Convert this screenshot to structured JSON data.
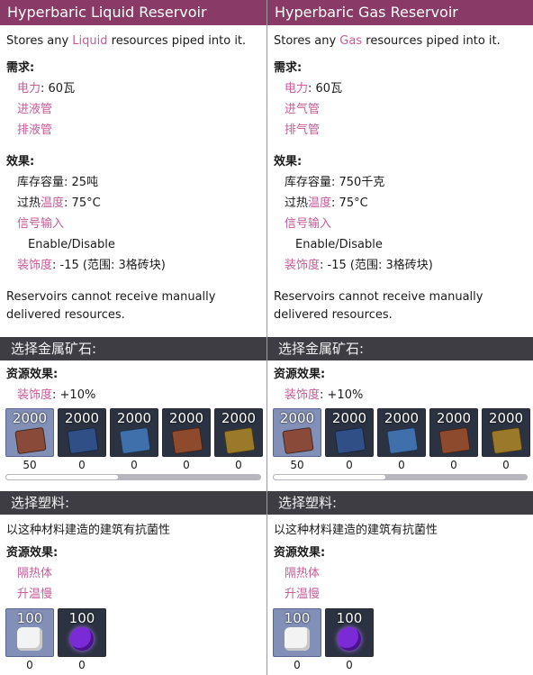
{
  "panels": [
    {
      "title": "Hyperbaric Liquid Reservoir",
      "desc_pre": "Stores any ",
      "desc_hl": "Liquid",
      "desc_post": " resources piped into it.",
      "req_title": "需求:",
      "power_label": "电力",
      "power_value": ": 60瓦",
      "input_pipe": "进液管",
      "output_pipe": "排液管",
      "effects_title": "效果:",
      "capacity": "库存容量: 25吨",
      "overheat_pre": "过热",
      "overheat_hl": "温度",
      "overheat_value": ": 75°C",
      "signal": "信号输入",
      "enable": "Enable/Disable",
      "decor_label": "装饰度",
      "decor_value": ": -15 (范围: 3格砖块)",
      "note": "Reservoirs cannot receive manually delivered resources.",
      "metal_bar": "选择金属矿石:",
      "res_effect_title": "资源效果:",
      "metal_decor_label": "装饰度",
      "metal_decor_value": ": +10%",
      "metal_tiles": [
        {
          "amount": "2000",
          "count": "50",
          "color": "#8a4a3a",
          "icon": "copper-ore-icon"
        },
        {
          "amount": "2000",
          "count": "0",
          "color": "#2f4f86",
          "icon": "cobalt-ore-icon"
        },
        {
          "amount": "2000",
          "count": "0",
          "color": "#3f70ab",
          "icon": "aluminum-ore-icon"
        },
        {
          "amount": "2000",
          "count": "0",
          "color": "#8e4a2c",
          "icon": "iron-ore-icon"
        },
        {
          "amount": "2000",
          "count": "0",
          "color": "#9a7a2a",
          "icon": "gold-amalgam-icon"
        }
      ],
      "plastic_bar": "选择塑料:",
      "plastic_desc": "以这种材料建造的建筑有抗菌性",
      "plastic_res_title": "资源效果:",
      "plastic_effect1": "隔热体",
      "plastic_effect2": "升温慢",
      "plastic_tiles": [
        {
          "amount": "100",
          "count": "0",
          "icon": "plastic-icon"
        },
        {
          "amount": "100",
          "count": "0",
          "icon": "super-plastic-icon"
        }
      ]
    },
    {
      "title": "Hyperbaric Gas Reservoir",
      "desc_pre": "Stores any ",
      "desc_hl": "Gas",
      "desc_post": " resources piped into it.",
      "req_title": "需求:",
      "power_label": "电力",
      "power_value": ": 60瓦",
      "input_pipe": "进气管",
      "output_pipe": "排气管",
      "effects_title": "效果:",
      "capacity": "库存容量: 750千克",
      "overheat_pre": "过热",
      "overheat_hl": "温度",
      "overheat_value": ": 75°C",
      "signal": "信号输入",
      "enable": "Enable/Disable",
      "decor_label": "装饰度",
      "decor_value": ": -15 (范围: 3格砖块)",
      "note": "Reservoirs cannot receive manually delivered resources.",
      "metal_bar": "选择金属矿石:",
      "res_effect_title": "资源效果:",
      "metal_decor_label": "装饰度",
      "metal_decor_value": ": +10%",
      "metal_tiles": [
        {
          "amount": "2000",
          "count": "50",
          "color": "#8a4a3a",
          "icon": "copper-ore-icon"
        },
        {
          "amount": "2000",
          "count": "0",
          "color": "#2f4f86",
          "icon": "cobalt-ore-icon"
        },
        {
          "amount": "2000",
          "count": "0",
          "color": "#3f70ab",
          "icon": "aluminum-ore-icon"
        },
        {
          "amount": "2000",
          "count": "0",
          "color": "#8e4a2c",
          "icon": "iron-ore-icon"
        },
        {
          "amount": "2000",
          "count": "0",
          "color": "#9a7a2a",
          "icon": "gold-amalgam-icon"
        }
      ],
      "plastic_bar": "选择塑料:",
      "plastic_desc": "以这种材料建造的建筑有抗菌性",
      "plastic_res_title": "资源效果:",
      "plastic_effect1": "隔热体",
      "plastic_effect2": "升温慢",
      "plastic_tiles": [
        {
          "amount": "100",
          "count": "0",
          "icon": "plastic-icon"
        },
        {
          "amount": "100",
          "count": "0",
          "icon": "super-plastic-icon"
        }
      ]
    }
  ],
  "colors": {
    "header": "#8a3a66",
    "highlight": "#c65b98",
    "bar": "#3d3d43",
    "selected_tile": "#8290b8"
  }
}
